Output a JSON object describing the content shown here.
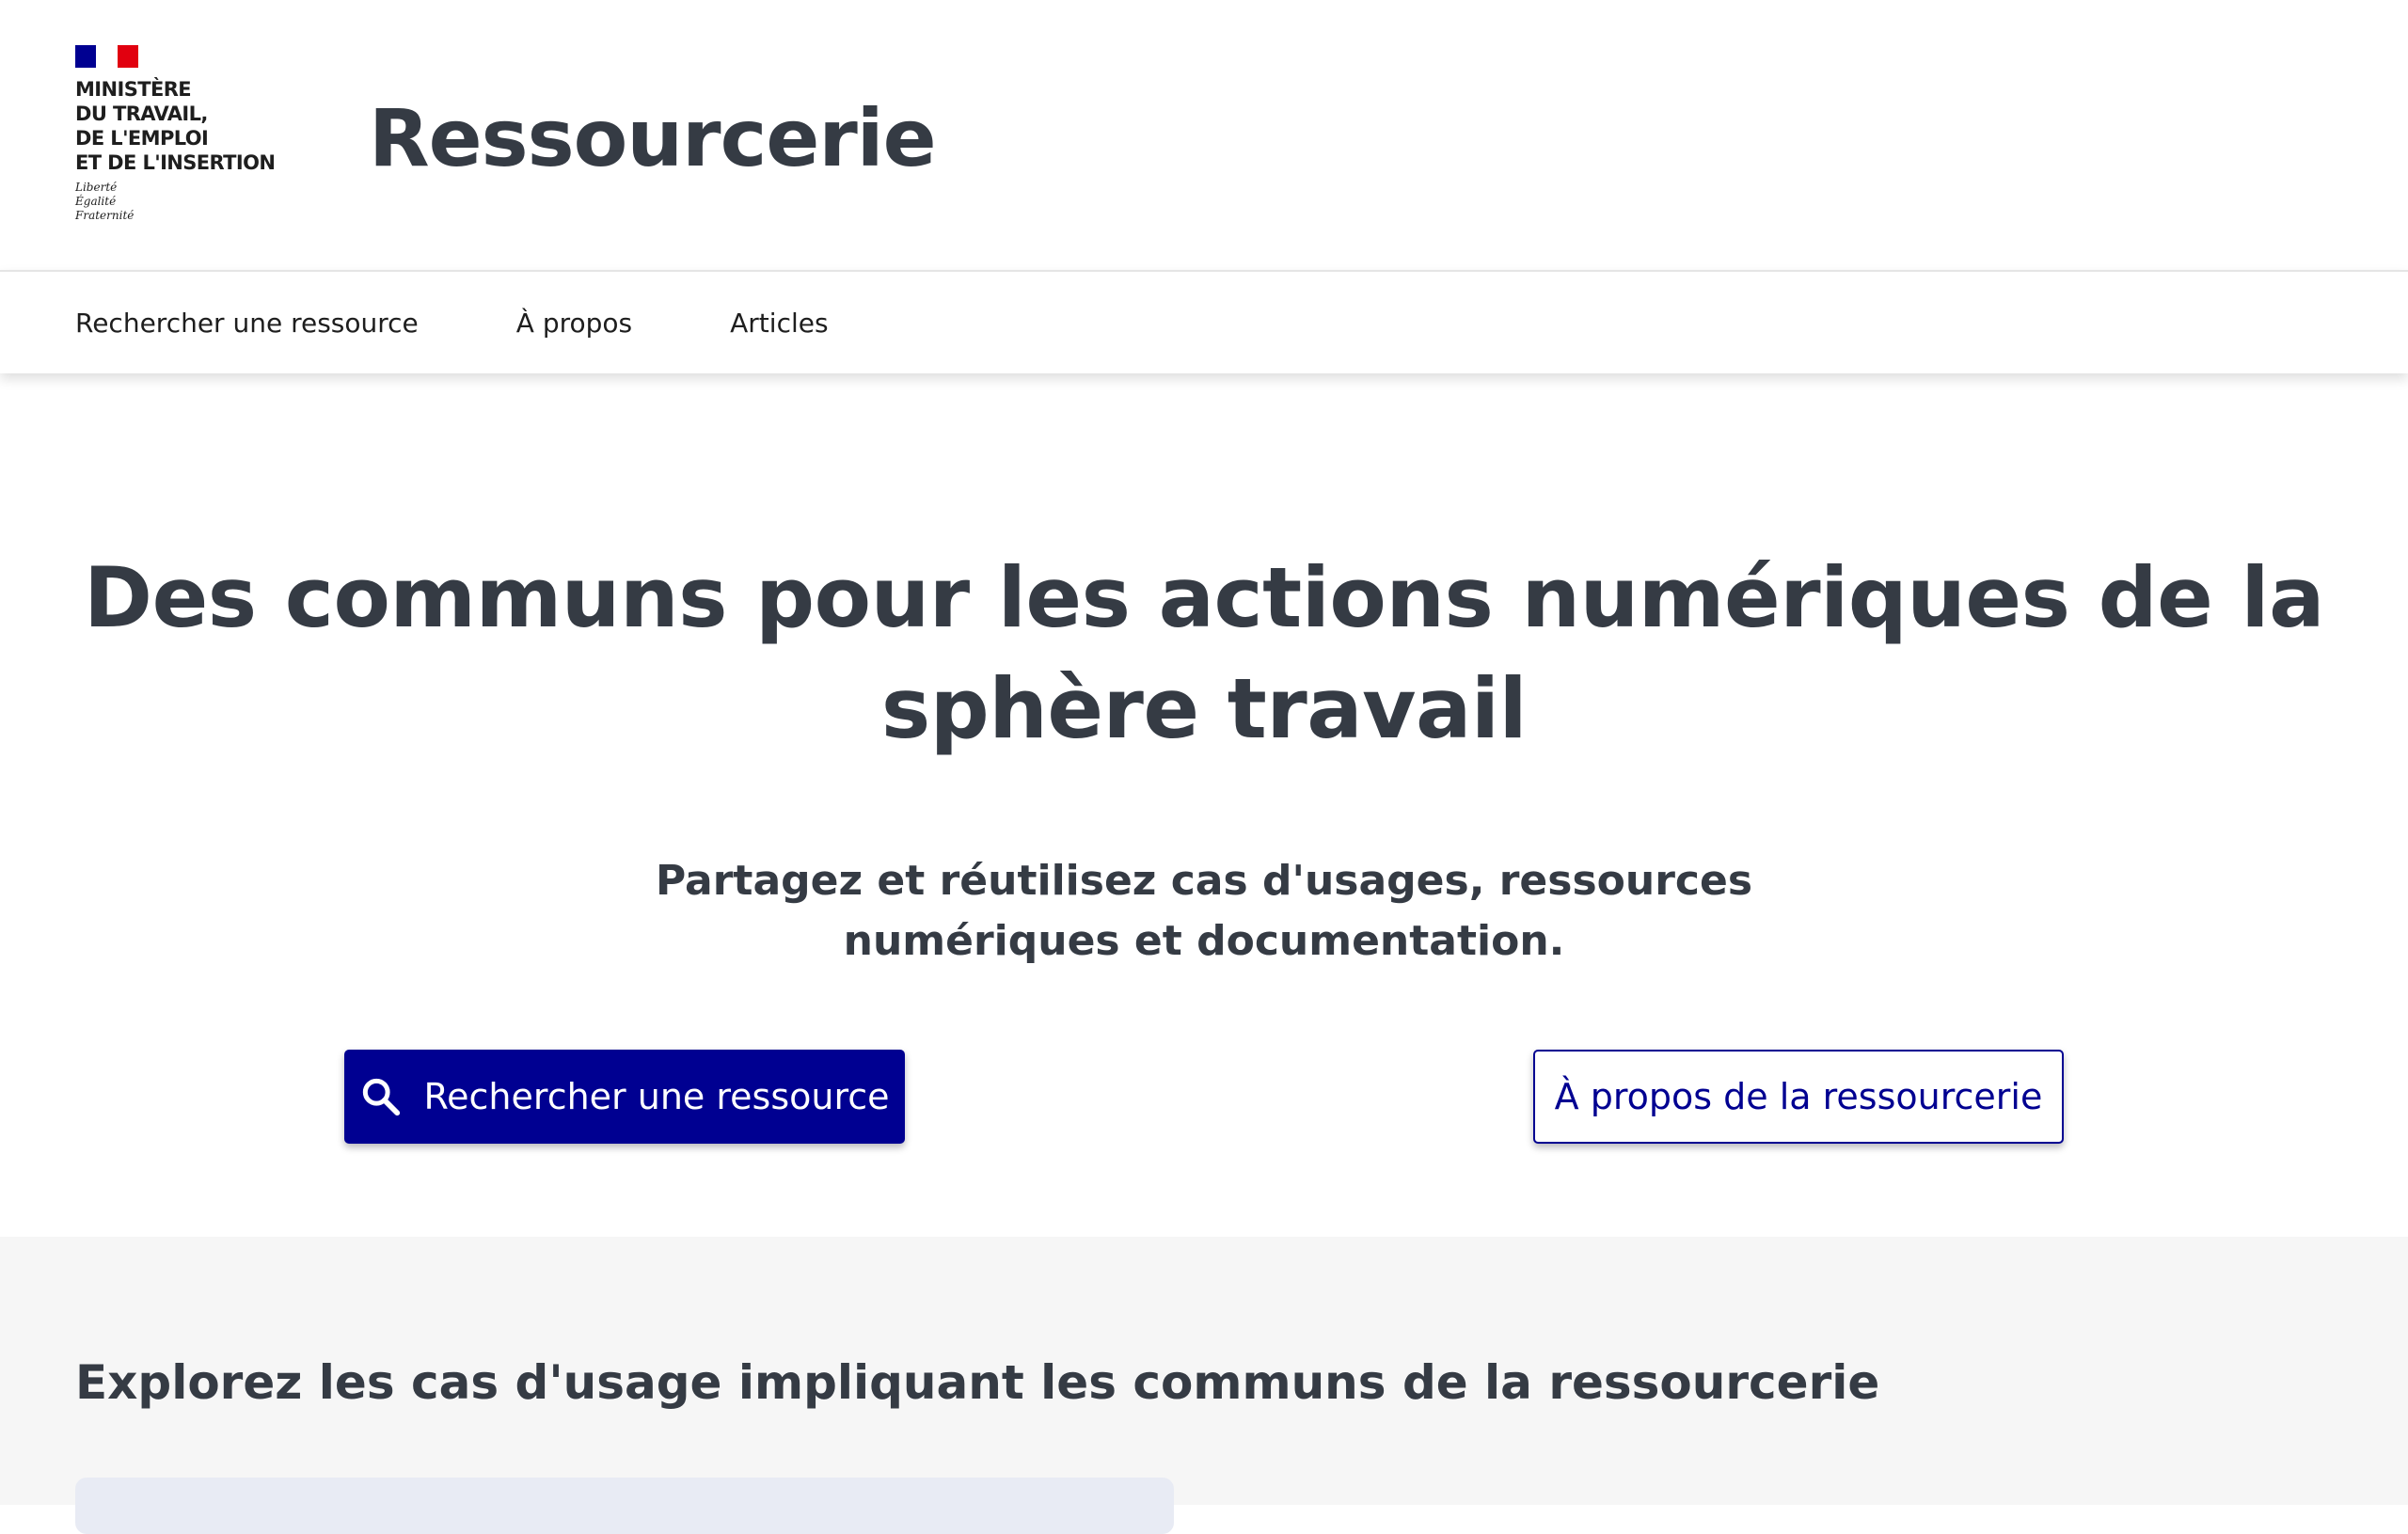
{
  "header": {
    "ministry_lines": [
      "MINISTÈRE",
      "DU TRAVAIL,",
      "DE L'EMPLOI",
      "ET DE L'INSERTION"
    ],
    "motto_lines": [
      "Liberté",
      "Égalité",
      "Fraternité"
    ],
    "site_title": "Ressourcerie",
    "flag_colors": [
      "#000091",
      "#ffffff",
      "#e1000f"
    ]
  },
  "nav": {
    "items": [
      {
        "label": "Rechercher une ressource"
      },
      {
        "label": "À propos"
      },
      {
        "label": "Articles"
      }
    ]
  },
  "hero": {
    "title": "Des communs pour les actions numériques de la sphère travail",
    "subtitle": "Partagez et réutilisez cas d'usages, ressources numériques et documentation.",
    "primary_button": {
      "label": "Rechercher une ressource",
      "icon": "search-icon"
    },
    "secondary_button": {
      "label": "À propos de la ressourcerie"
    }
  },
  "explore": {
    "title": "Explorez les cas d'usage impliquant les communs de la ressourcerie"
  },
  "colors": {
    "primary": "#000091",
    "text": "#353b44",
    "section_bg": "#f6f6f6",
    "card_bg": "#e8ebf4"
  }
}
